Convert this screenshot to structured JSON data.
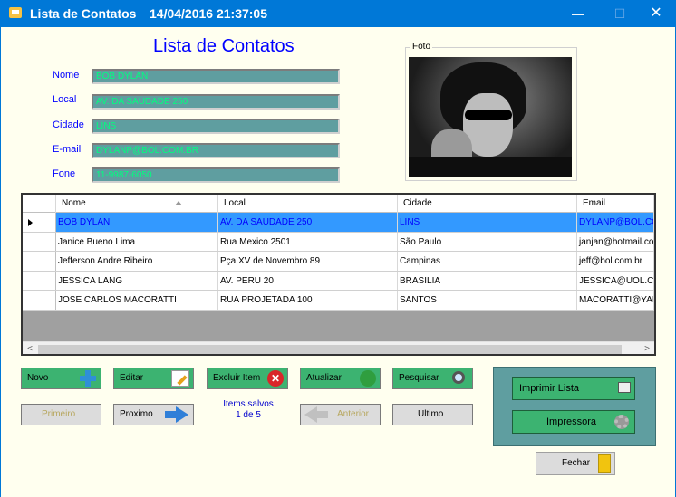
{
  "window": {
    "title": "Lista de Contatos",
    "datetime": "14/04/2016 21:37:05",
    "min_glyph": "—",
    "max_glyph": "☐",
    "close_glyph": "✕"
  },
  "form": {
    "heading": "Lista de Contatos",
    "photo_label": "Foto",
    "fields": {
      "nome": {
        "label": "Nome",
        "value": "BOB DYLAN"
      },
      "local": {
        "label": "Local",
        "value": "AV.  DA SAUDADE 250"
      },
      "cidade": {
        "label": "Cidade",
        "value": "LINS"
      },
      "email": {
        "label": "E-mail",
        "value": "DYLANP@BOL.COM.BR"
      },
      "fone": {
        "label": "Fone",
        "value": "11-9987-6050"
      }
    }
  },
  "grid": {
    "columns": [
      "Nome",
      "Local",
      "Cidade",
      "Email"
    ],
    "rows": [
      [
        "BOB DYLAN",
        "AV.  DA SAUDADE 250",
        "LINS",
        "DYLANP@BOL.COM.BR"
      ],
      [
        "Janice Bueno Lima",
        "Rua Mexico 2501",
        "São Paulo",
        "janjan@hotmail.com"
      ],
      [
        "Jefferson Andre Ribeiro",
        "Pça XV de Novembro 89",
        "Campinas",
        "jeff@bol.com.br"
      ],
      [
        "JESSICA LANG",
        "AV. PERU 20",
        "BRASILIA",
        "JESSICA@UOL.COM.BR"
      ],
      [
        "JOSE CARLOS MACORATTI",
        "RUA PROJETADA 100",
        "SANTOS",
        "MACORATTI@YAHOO.COM"
      ]
    ],
    "selected_row": 0,
    "scroll_left": "<",
    "scroll_right": ">"
  },
  "buttons": {
    "novo": "Novo",
    "editar": "Editar",
    "excluir": "Excluir Item",
    "atualizar": "Atualizar",
    "pesquisar": "Pesquisar",
    "primeiro": "Primeiro",
    "proximo": "Proximo",
    "anterior": "Anterior",
    "ultimo": "Ultimo",
    "imprimir_lista": "Imprimir Lista",
    "impressora": "Impressora",
    "fechar": "Fechar"
  },
  "status": {
    "items_saved": "Items salvos",
    "position": "1 de 5"
  }
}
